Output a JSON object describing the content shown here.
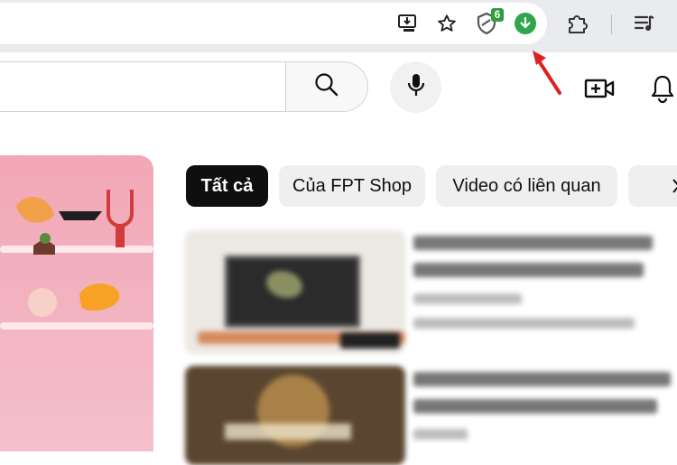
{
  "browser": {
    "extension_badge_count": "6"
  },
  "youtube": {
    "chips": [
      {
        "label": "Tất cả",
        "active": true
      },
      {
        "label": "Của FPT Shop",
        "active": false
      },
      {
        "label": "Video có liên quan",
        "active": false
      }
    ]
  },
  "colors": {
    "download_extension": "#2fa64b",
    "annotation_arrow": "#e02020",
    "chip_active_bg": "#0f0f0f",
    "chip_bg": "#efefef"
  },
  "icons": {
    "toolbar": [
      "install-app-icon",
      "star-icon",
      "shield-extension-icon",
      "download-extension-icon",
      "extensions-puzzle-icon",
      "reading-list-icon"
    ],
    "header": [
      "search-icon",
      "microphone-icon",
      "create-video-icon",
      "notifications-bell-icon"
    ]
  }
}
